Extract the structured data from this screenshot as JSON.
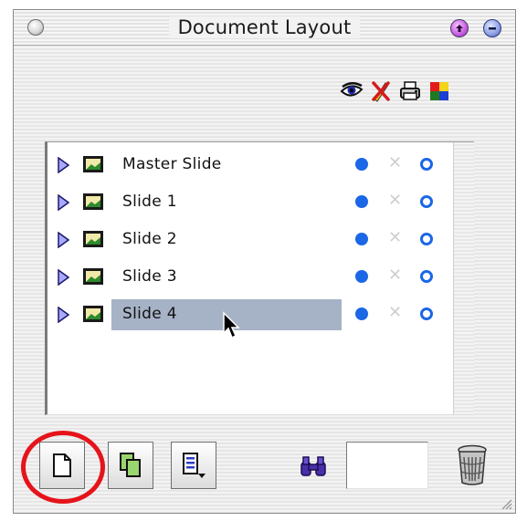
{
  "window": {
    "title": "Document Layout"
  },
  "toolbar": {
    "icons": [
      "eye-icon",
      "no-edit-icon",
      "printer-icon",
      "color-square-icon"
    ]
  },
  "slides": [
    {
      "label": "Master Slide",
      "selected": false
    },
    {
      "label": "Slide 1",
      "selected": false
    },
    {
      "label": "Slide 2",
      "selected": false
    },
    {
      "label": "Slide 3",
      "selected": false
    },
    {
      "label": "Slide 4",
      "selected": true
    }
  ],
  "colors": {
    "selection": "#a6b2c6",
    "status_dot": "#1b67e6",
    "highlight_circle": "#e5141a"
  },
  "bottom": {
    "find_value": ""
  }
}
